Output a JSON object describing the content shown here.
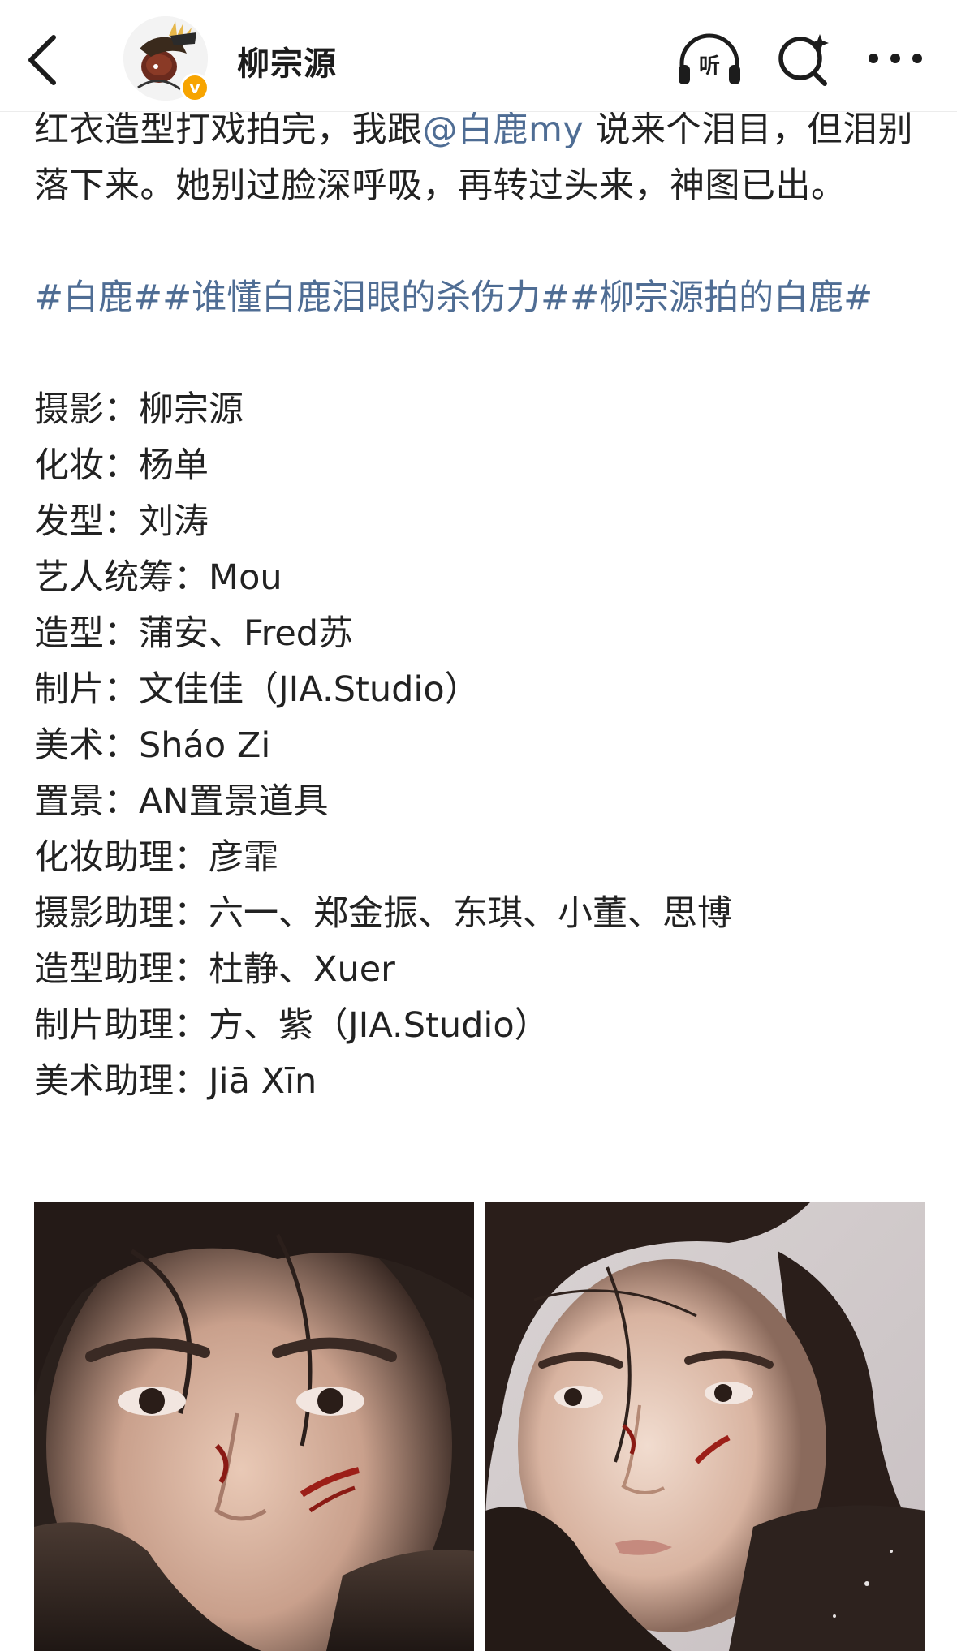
{
  "header": {
    "username": "柳宗源",
    "verified_badge": "v",
    "listen_label": "听"
  },
  "post": {
    "text_before_mention": "红衣造型打戏拍完，我跟",
    "mention": "@白鹿my",
    "text_after_mention": "说来个泪目，但泪别落下来。她别过脸深呼吸，再转过头来，神图已出。",
    "hashtags": [
      "#白鹿#",
      "#谁懂白鹿泪眼的杀伤力#",
      "#柳宗源拍的白鹿#"
    ],
    "credits": [
      {
        "role": "摄影：",
        "name": "柳宗源"
      },
      {
        "role": "化妆：",
        "name": "杨单"
      },
      {
        "role": "发型：",
        "name": "刘涛"
      },
      {
        "role": "艺人统筹：",
        "name": "Mou"
      },
      {
        "role": "造型：",
        "name": "蒲安、Fred苏"
      },
      {
        "role": "制片：",
        "name": "文佳佳（JIA.Studio）"
      },
      {
        "role": "美术：",
        "name": "Sháo Zi"
      },
      {
        "role": "置景：",
        "name": "AN置景道具"
      },
      {
        "role": "化妆助理：",
        "name": "彦霏"
      },
      {
        "role": "摄影助理：",
        "name": "六一、郑金振、东琪、小董、思博"
      },
      {
        "role": "造型助理：",
        "name": "杜静、Xuer"
      },
      {
        "role": "制片助理：",
        "name": "方、紫（JIA.Studio）"
      },
      {
        "role": "美术助理：",
        "name": "Jiā Xīn"
      }
    ]
  },
  "icons": {
    "back": "chevron-left-icon",
    "listen": "headphones-icon",
    "search": "search-icon",
    "more": "more-dots-icon"
  },
  "colors": {
    "link": "#4f6d94",
    "verified": "#f7a400",
    "text": "#222222"
  }
}
